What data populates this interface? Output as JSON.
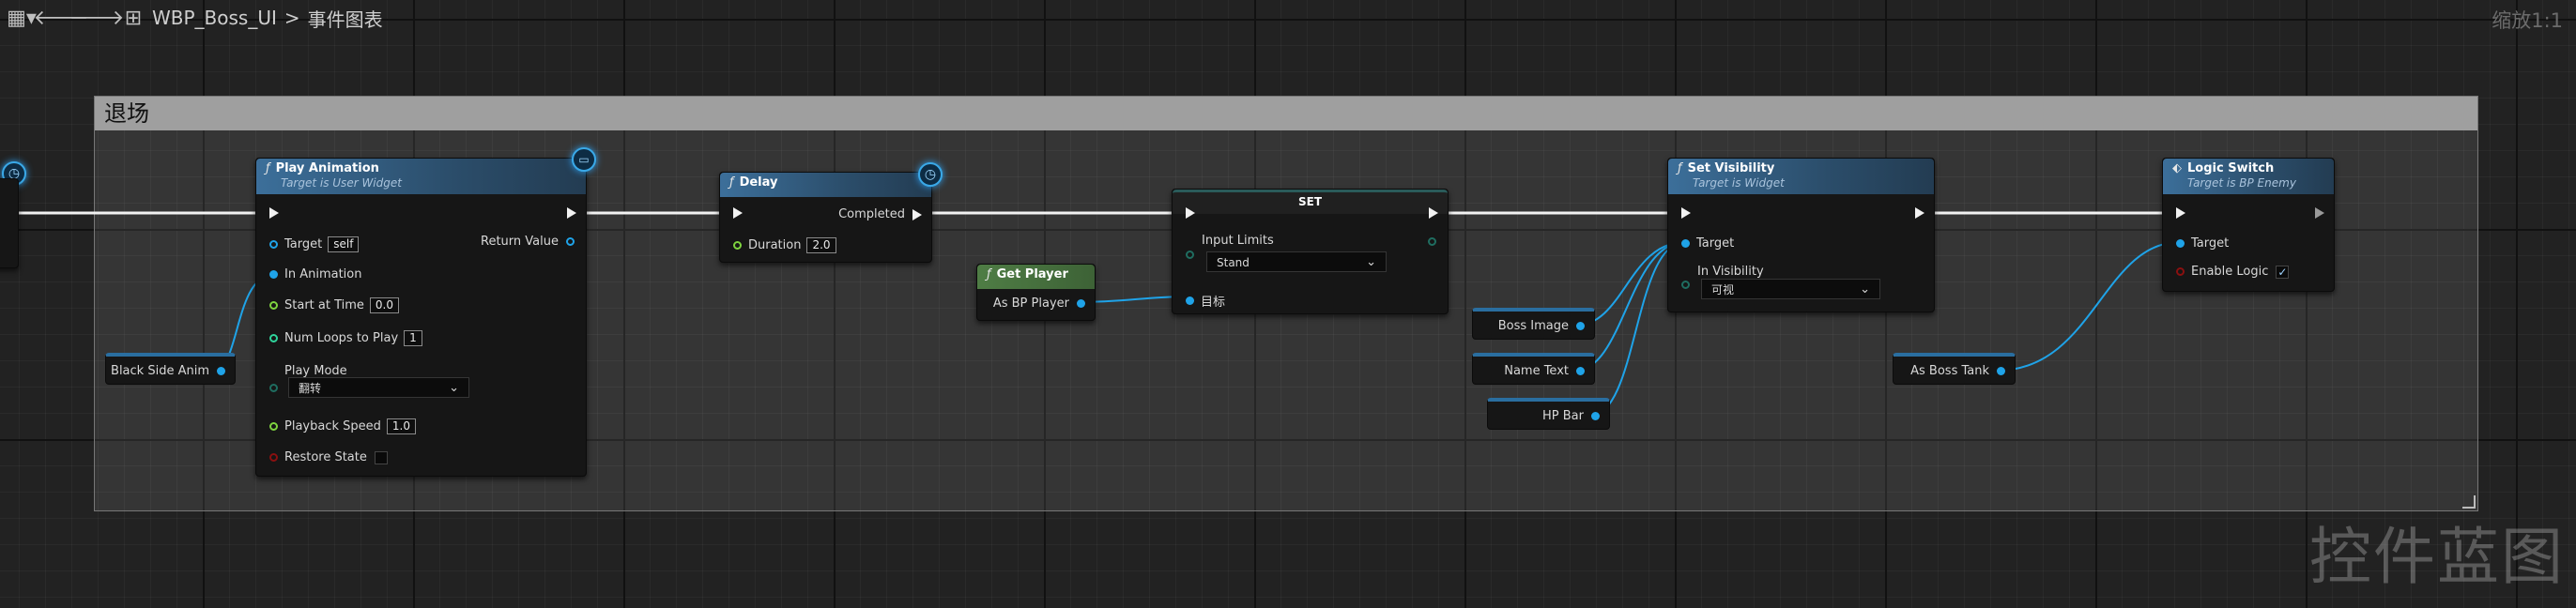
{
  "toolbar": {
    "breadcrumb_asset": "WBP_Boss_UI",
    "breadcrumb_sep": ">",
    "breadcrumb_graph": "事件图表",
    "zoom": "缩放1:1"
  },
  "comment": {
    "title": "退场"
  },
  "nodes": {
    "play_animation": {
      "title": "Play Animation",
      "subtitle": "Target is User Widget",
      "target_label": "Target",
      "target_value": "self",
      "return_label": "Return Value",
      "in_animation": "In Animation",
      "start_at_time": "Start at Time",
      "start_at_time_value": "0.0",
      "num_loops": "Num Loops to Play",
      "num_loops_value": "1",
      "play_mode": "Play Mode",
      "play_mode_value": "翻转",
      "playback_speed": "Playback Speed",
      "playback_speed_value": "1.0",
      "restore_state": "Restore State"
    },
    "delay": {
      "title": "Delay",
      "completed": "Completed",
      "duration": "Duration",
      "duration_value": "2.0"
    },
    "get_player": {
      "title": "Get Player",
      "output": "As BP Player"
    },
    "set": {
      "title": "SET",
      "input_limits": "Input Limits",
      "input_limits_value": "Stand",
      "target": "目标"
    },
    "set_visibility": {
      "title": "Set Visibility",
      "subtitle": "Target is Widget",
      "target": "Target",
      "in_visibility": "In Visibility",
      "in_visibility_value": "可视"
    },
    "logic_switch": {
      "title": "Logic Switch",
      "subtitle": "Target is BP Enemy",
      "target": "Target",
      "enable_logic": "Enable Logic",
      "enable_logic_checked": "✓"
    },
    "vars": {
      "black_side_anim": "Black Side Anim",
      "boss_image": "Boss Image",
      "name_text": "Name Text",
      "hp_bar": "HP Bar",
      "as_boss_tank": "As Boss Tank"
    }
  },
  "watermark": "控件蓝图",
  "colors": {
    "exec_wire": "#f2f2f2",
    "object_wire": "#1fa3e8",
    "header_blue": "#3c6f9a",
    "header_green": "#4f7d45"
  }
}
